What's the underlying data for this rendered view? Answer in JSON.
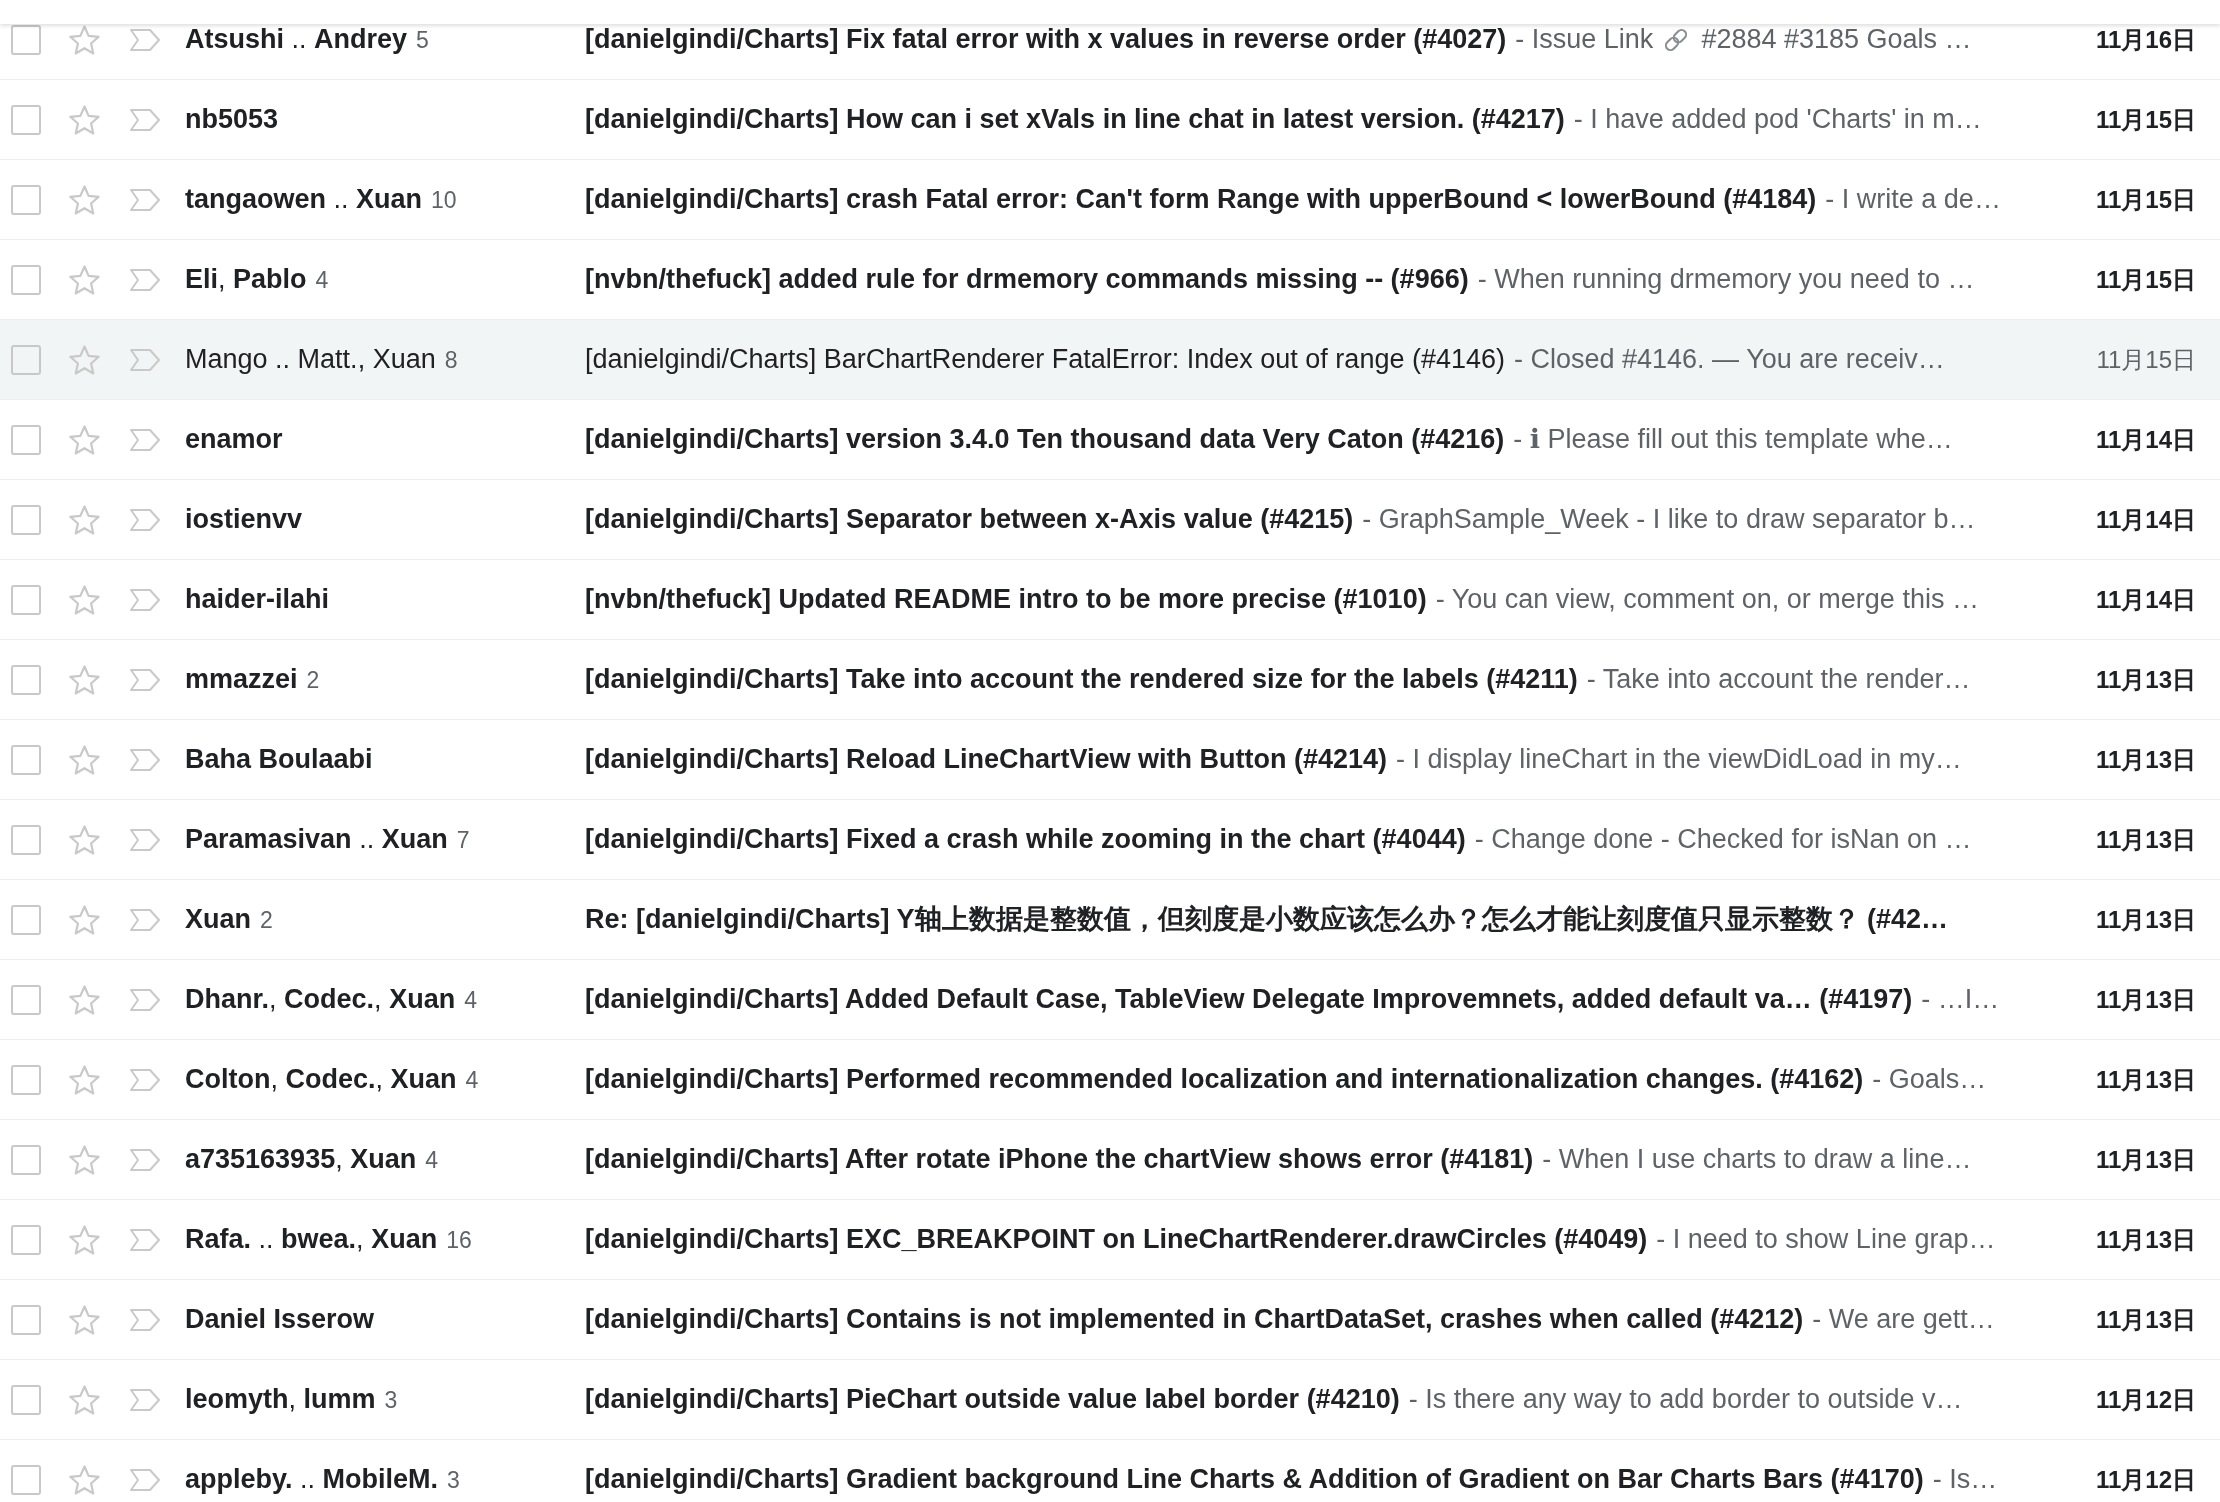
{
  "mail_list": {
    "rows": [
      {
        "selected": false,
        "starred": false,
        "important": false,
        "unread": true,
        "senders": [
          {
            "kind": "name",
            "text": "Atsushi"
          },
          {
            "kind": "skip",
            "text": ".."
          },
          {
            "kind": "name",
            "text": "Andrey"
          }
        ],
        "count": "5",
        "subject": "[danielgindi/Charts] Fix fatal error with x values in reverse order (#4027)",
        "snippet": "- Issue Link",
        "snippet_continued": "#2884 #3185 Goals …",
        "date": "11月16日"
      },
      {
        "selected": false,
        "starred": false,
        "important": false,
        "unread": true,
        "senders": [
          {
            "kind": "name",
            "text": "nb5053"
          }
        ],
        "subject": "[danielgindi/Charts] How can i set xVals in line chat in latest version. (#4217)",
        "snippet": "- I have added pod 'Charts' in m…",
        "date": "11月15日"
      },
      {
        "selected": false,
        "starred": false,
        "important": false,
        "unread": true,
        "senders": [
          {
            "kind": "name",
            "text": "tangaowen"
          },
          {
            "kind": "skip",
            "text": ".."
          },
          {
            "kind": "name",
            "text": "Xuan"
          }
        ],
        "count": "10",
        "subject": "[danielgindi/Charts] crash Fatal error: Can't form Range with upperBound < lowerBound (#4184)",
        "snippet": "- I write a de…",
        "date": "11月15日"
      },
      {
        "selected": false,
        "starred": false,
        "important": false,
        "unread": true,
        "senders": [
          {
            "kind": "name",
            "text": "Eli"
          },
          {
            "kind": "comma",
            "text": ","
          },
          {
            "kind": "name",
            "text": "Pablo"
          }
        ],
        "count": "4",
        "subject": "[nvbn/thefuck] added rule for drmemory commands missing -- (#966)",
        "snippet": "- When running drmemory you need to …",
        "date": "11月15日"
      },
      {
        "selected": false,
        "starred": false,
        "important": false,
        "unread": false,
        "senders": [
          {
            "kind": "name",
            "text": "Mango"
          },
          {
            "kind": "skip",
            "text": ".."
          },
          {
            "kind": "name",
            "text": "Matt."
          },
          {
            "kind": "comma",
            "text": ","
          },
          {
            "kind": "name",
            "text": "Xuan"
          }
        ],
        "count": "8",
        "subject": "[danielgindi/Charts] BarChartRenderer FatalError: Index out of range (#4146)",
        "snippet": "- Closed #4146. — You are receiv…",
        "date": "11月15日"
      },
      {
        "selected": false,
        "starred": false,
        "important": false,
        "unread": true,
        "senders": [
          {
            "kind": "name",
            "text": "enamor"
          }
        ],
        "subject": "[danielgindi/Charts] version 3.4.0 Ten thousand data Very Caton (#4216)",
        "snippet": "- ℹ Please fill out this template whe…",
        "date": "11月14日"
      },
      {
        "selected": false,
        "starred": false,
        "important": false,
        "unread": true,
        "senders": [
          {
            "kind": "name",
            "text": "iostienvv"
          }
        ],
        "subject": "[danielgindi/Charts] Separator between x-Axis value (#4215)",
        "snippet": "- GraphSample_Week - I like to draw separator b…",
        "date": "11月14日"
      },
      {
        "selected": false,
        "starred": false,
        "important": false,
        "unread": true,
        "senders": [
          {
            "kind": "name",
            "text": "haider-ilahi"
          }
        ],
        "subject": "[nvbn/thefuck] Updated README intro to be more precise (#1010)",
        "snippet": "- You can view, comment on, or merge this …",
        "date": "11月14日"
      },
      {
        "selected": false,
        "starred": false,
        "important": false,
        "unread": true,
        "senders": [
          {
            "kind": "name",
            "text": "mmazzei"
          }
        ],
        "count": "2",
        "subject": "[danielgindi/Charts] Take into account the rendered size for the labels (#4211)",
        "snippet": "- Take into account the render…",
        "date": "11月13日"
      },
      {
        "selected": false,
        "starred": false,
        "important": false,
        "unread": true,
        "senders": [
          {
            "kind": "name",
            "text": "Baha Boulaabi"
          }
        ],
        "subject": "[danielgindi/Charts] Reload LineChartView with Button (#4214)",
        "snippet": "- I display lineChart in the viewDidLoad in my…",
        "date": "11月13日"
      },
      {
        "selected": false,
        "starred": false,
        "important": false,
        "unread": true,
        "senders": [
          {
            "kind": "name",
            "text": "Paramasivan"
          },
          {
            "kind": "skip",
            "text": ".."
          },
          {
            "kind": "name",
            "text": "Xuan"
          }
        ],
        "count": "7",
        "subject": "[danielgindi/Charts] Fixed a crash while zooming in the chart (#4044)",
        "snippet": "- Change done - Checked for isNan on …",
        "date": "11月13日"
      },
      {
        "selected": false,
        "starred": false,
        "important": false,
        "unread": true,
        "senders": [
          {
            "kind": "name",
            "text": "Xuan"
          }
        ],
        "count": "2",
        "subject": "Re: [danielgindi/Charts] Y轴上数据是整数值，但刻度是小数应该怎么办？怎么才能让刻度值只显示整数？ (#42…",
        "date": "11月13日"
      },
      {
        "selected": false,
        "starred": false,
        "important": false,
        "unread": true,
        "senders": [
          {
            "kind": "name",
            "text": "Dhanr."
          },
          {
            "kind": "comma",
            "text": ","
          },
          {
            "kind": "name",
            "text": "Codec."
          },
          {
            "kind": "comma",
            "text": ","
          },
          {
            "kind": "name",
            "text": "Xuan"
          }
        ],
        "count": "4",
        "subject": "[danielgindi/Charts] Added Default Case, TableView Delegate Improvemnets, added default va… (#4197)",
        "snippet": "- …I…",
        "date": "11月13日"
      },
      {
        "selected": false,
        "starred": false,
        "important": false,
        "unread": true,
        "senders": [
          {
            "kind": "name",
            "text": "Colton"
          },
          {
            "kind": "comma",
            "text": ","
          },
          {
            "kind": "name",
            "text": "Codec."
          },
          {
            "kind": "comma",
            "text": ","
          },
          {
            "kind": "name",
            "text": "Xuan"
          }
        ],
        "count": "4",
        "subject": "[danielgindi/Charts] Performed recommended localization and internationalization changes. (#4162)",
        "snippet": "- Goals…",
        "date": "11月13日"
      },
      {
        "selected": false,
        "starred": false,
        "important": false,
        "unread": true,
        "senders": [
          {
            "kind": "name",
            "text": "a735163935"
          },
          {
            "kind": "comma",
            "text": ","
          },
          {
            "kind": "name",
            "text": "Xuan"
          }
        ],
        "count": "4",
        "subject": "[danielgindi/Charts] After rotate iPhone the chartView shows error (#4181)",
        "snippet": "- When I use charts to draw a line…",
        "date": "11月13日"
      },
      {
        "selected": false,
        "starred": false,
        "important": false,
        "unread": true,
        "senders": [
          {
            "kind": "name",
            "text": "Rafa."
          },
          {
            "kind": "skip",
            "text": ".."
          },
          {
            "kind": "name",
            "text": "bwea."
          },
          {
            "kind": "comma",
            "text": ","
          },
          {
            "kind": "name",
            "text": "Xuan"
          }
        ],
        "count": "16",
        "subject": "[danielgindi/Charts] EXC_BREAKPOINT on LineChartRenderer.drawCircles (#4049)",
        "snippet": "- I need to show Line grap…",
        "date": "11月13日"
      },
      {
        "selected": false,
        "starred": false,
        "important": false,
        "unread": true,
        "senders": [
          {
            "kind": "name",
            "text": "Daniel Isserow"
          }
        ],
        "subject": "[danielgindi/Charts] Contains is not implemented in ChartDataSet, crashes when called (#4212)",
        "snippet": "- We are gett…",
        "date": "11月13日"
      },
      {
        "selected": false,
        "starred": false,
        "important": false,
        "unread": true,
        "senders": [
          {
            "kind": "name",
            "text": "leomyth"
          },
          {
            "kind": "comma",
            "text": ","
          },
          {
            "kind": "name",
            "text": "lumm"
          }
        ],
        "count": "3",
        "subject": "[danielgindi/Charts] PieChart outside value label border (#4210)",
        "snippet": "- Is there any way to add border to outside v…",
        "date": "11月12日"
      },
      {
        "selected": false,
        "starred": false,
        "important": false,
        "unread": true,
        "senders": [
          {
            "kind": "name",
            "text": "appleby."
          },
          {
            "kind": "skip",
            "text": ".."
          },
          {
            "kind": "name",
            "text": "MobileM."
          }
        ],
        "count": "3",
        "subject": "[danielgindi/Charts] Gradient background Line Charts & Addition of Gradient on Bar Charts Bars (#4170)",
        "snippet": "- Is…",
        "date": "11月12日"
      }
    ]
  }
}
